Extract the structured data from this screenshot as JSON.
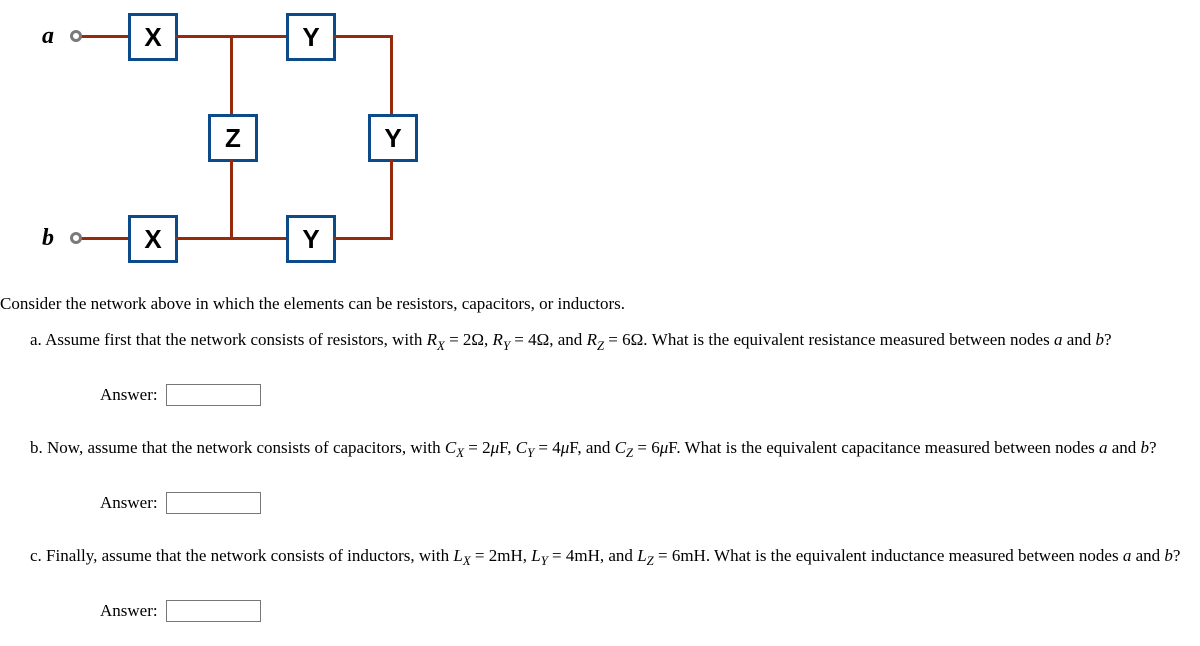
{
  "circuit": {
    "node_a": "a",
    "node_b": "b",
    "x_label": "X",
    "y_label": "Y",
    "z_label": "Z"
  },
  "intro": "Consider the network above in which the elements can be resistors, capacitors, or inductors.",
  "parts": {
    "a": {
      "prefix": "a. Assume first that the network consists of resistors, with ",
      "rx_sym": "R",
      "rx_sub": "X",
      "rx_eq": " = 2Ω, ",
      "ry_sym": "R",
      "ry_sub": "Y",
      "ry_eq": " = 4Ω, and ",
      "rz_sym": "R",
      "rz_sub": "Z",
      "rz_eq": " = 6Ω. What is the equivalent resistance measured between nodes ",
      "na": "a",
      "mid": " and ",
      "nb": "b",
      "suffix": "?"
    },
    "b": {
      "prefix": "b. Now, assume that the network consists of capacitors, with ",
      "cx_sym": "C",
      "cx_sub": "X",
      "cx_eq": " = 2",
      "mu1": "μ",
      "cx_unit": "F, ",
      "cy_sym": "C",
      "cy_sub": "Y",
      "cy_eq": " = 4",
      "mu2": "μ",
      "cy_unit": "F, and ",
      "cz_sym": "C",
      "cz_sub": "Z",
      "cz_eq": " = 6",
      "mu3": "μ",
      "cz_unit": "F. What is the equivalent capacitance measured between nodes ",
      "na": "a",
      "mid": " and ",
      "nb": "b",
      "suffix": "?"
    },
    "c": {
      "prefix": "c. Finally, assume that the network consists of inductors, with ",
      "lx_sym": "L",
      "lx_sub": "X",
      "lx_eq": " = 2mH, ",
      "ly_sym": "L",
      "ly_sub": "Y",
      "ly_eq": " = 4mH, and ",
      "lz_sym": "L",
      "lz_sub": "Z",
      "lz_eq": " = 6mH. What is the equivalent inductance measured between nodes ",
      "na": "a",
      "mid": " and ",
      "nb": "b",
      "suffix": "?"
    }
  },
  "answer_label": "Answer:"
}
